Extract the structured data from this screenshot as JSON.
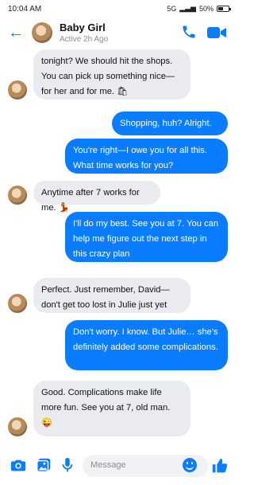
{
  "status": {
    "time": "10:04 AM",
    "network": "5G",
    "battery": "50%",
    "battery_level": 0.5
  },
  "header": {
    "name": "Baby Girl",
    "subtitle": "Active 2h Ago"
  },
  "messages": [
    {
      "from": "them",
      "text": "tonight? We should hit the shops. You can pick up something nice—for her and for me. 🛍"
    },
    {
      "from": "me",
      "text": "Shopping, huh? Alright."
    },
    {
      "from": "me",
      "text": "You're right—I owe you for all this. What time works for you?"
    },
    {
      "from": "them",
      "text": "Anytime after 7 works for me. 💃"
    },
    {
      "from": "me",
      "text": "I'll do my best. See you at 7. You can help me figure out the next step in this crazy plan"
    },
    {
      "from": "them",
      "text": "Perfect. Just remember, David—don't get too lost in Julie just yet"
    },
    {
      "from": "me",
      "text": "Don't worry. I know. But Julie… she's definitely added some complications."
    },
    {
      "from": "them",
      "text": "Good. Complications make life more fun. See you at 7, old man. 😜"
    }
  ],
  "composer": {
    "placeholder": "Message"
  },
  "colors": {
    "accent": "#0a7cff",
    "incoming": "#e9ebee"
  },
  "icons": [
    "back-arrow-icon",
    "phone-icon",
    "video-icon",
    "camera-icon",
    "image-icon",
    "microphone-icon",
    "emoji-icon",
    "like-icon"
  ]
}
